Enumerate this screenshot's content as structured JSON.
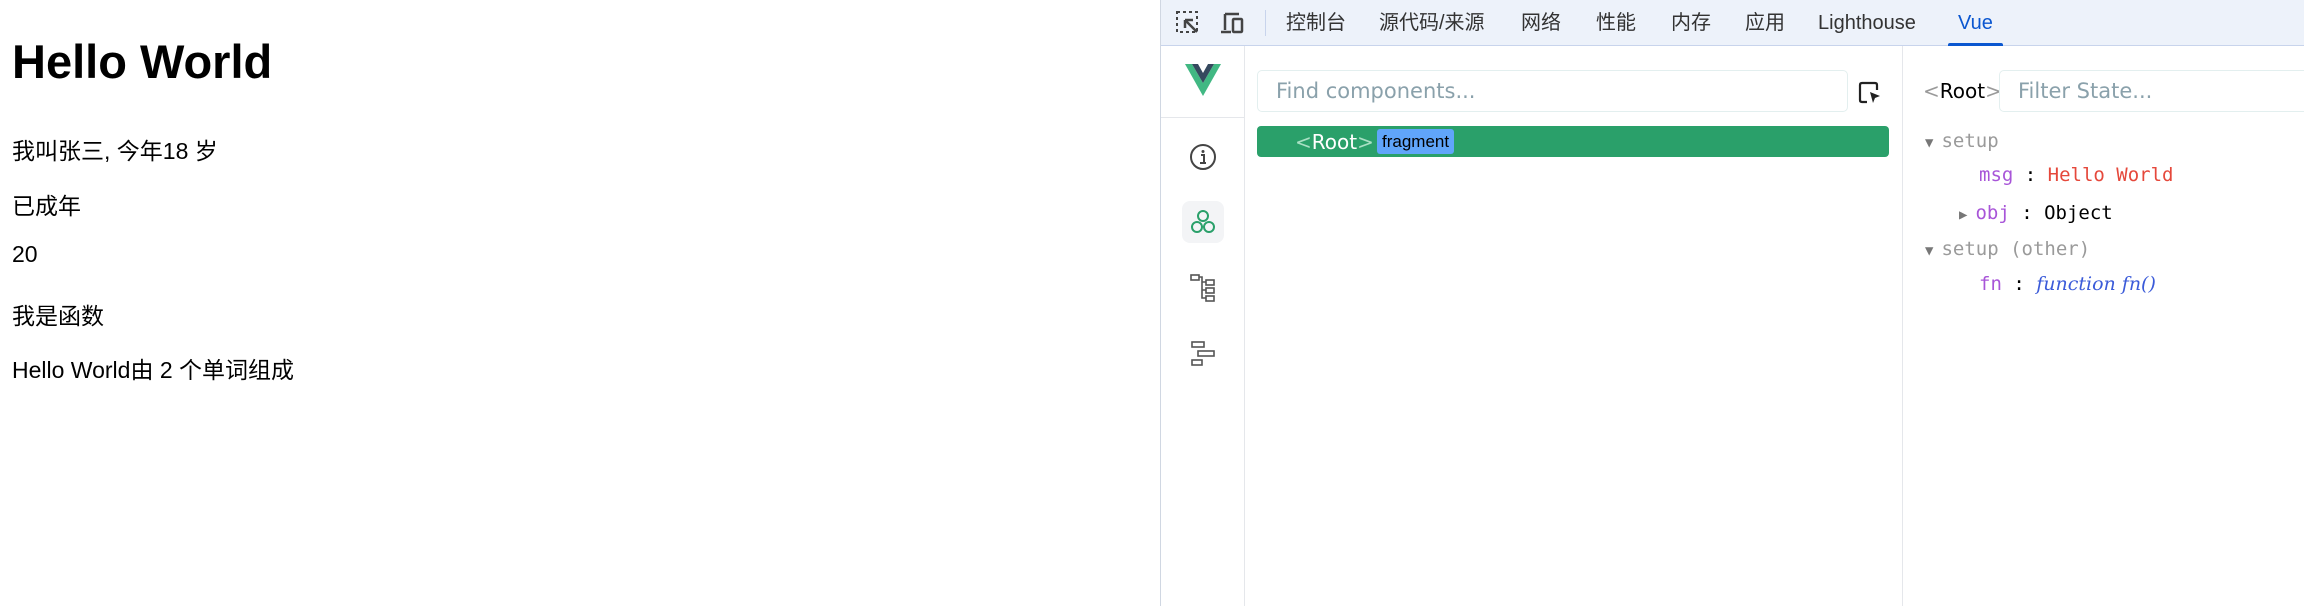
{
  "page": {
    "heading": "Hello World",
    "lines": [
      "我叫张三, 今年18 岁",
      "已成年",
      "20",
      "我是函数",
      "Hello World由 2 个单词组成"
    ]
  },
  "devtools": {
    "tabs": [
      "控制台",
      "源代码/来源",
      "网络",
      "性能",
      "内存",
      "应用",
      "Lighthouse",
      "Vue"
    ],
    "active_tab": "Vue",
    "components": {
      "search_placeholder": "Find components...",
      "root_open": "<",
      "root_name": "Root",
      "root_close": ">",
      "root_badge": "fragment"
    },
    "state": {
      "component": "Root",
      "filter_placeholder": "Filter State...",
      "sections": [
        {
          "label": "setup",
          "items": [
            {
              "key": "msg",
              "value": "Hello World"
            },
            {
              "key": "obj",
              "value": "Object"
            }
          ]
        },
        {
          "label": "setup (other)",
          "items": [
            {
              "key": "fn",
              "value": "function fn()"
            }
          ]
        }
      ]
    },
    "colors": {
      "accent": "#0b57d0",
      "vue_green": "#2aa06a",
      "badge": "#60a5fa"
    }
  }
}
